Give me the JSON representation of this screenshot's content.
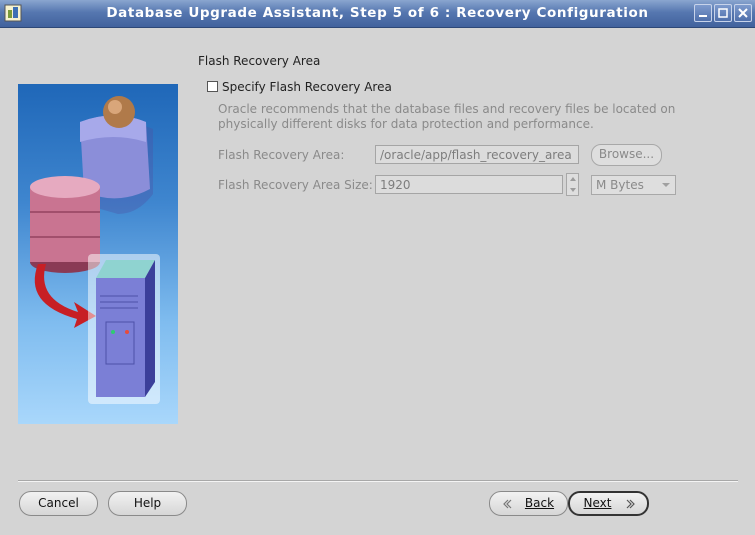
{
  "window": {
    "title": "Database Upgrade Assistant, Step 5 of 6 : Recovery Configuration",
    "controls": [
      "minimize-icon",
      "maximize-icon",
      "close-icon"
    ]
  },
  "section": {
    "title": "Flash Recovery Area",
    "checkbox_label": "Specify Flash Recovery Area",
    "checkbox_checked": false,
    "description": "Oracle recommends that the database files and recovery files be located on physically different disks for data protection and performance."
  },
  "form": {
    "area_label": "Flash Recovery Area:",
    "area_value": "/oracle/app/flash_recovery_area",
    "browse_label": "Browse...",
    "size_label": "Flash Recovery Area Size:",
    "size_value": "1920",
    "unit_value": "M Bytes"
  },
  "buttons": {
    "cancel": "Cancel",
    "help": "Help",
    "back": "Back",
    "next": "Next"
  }
}
